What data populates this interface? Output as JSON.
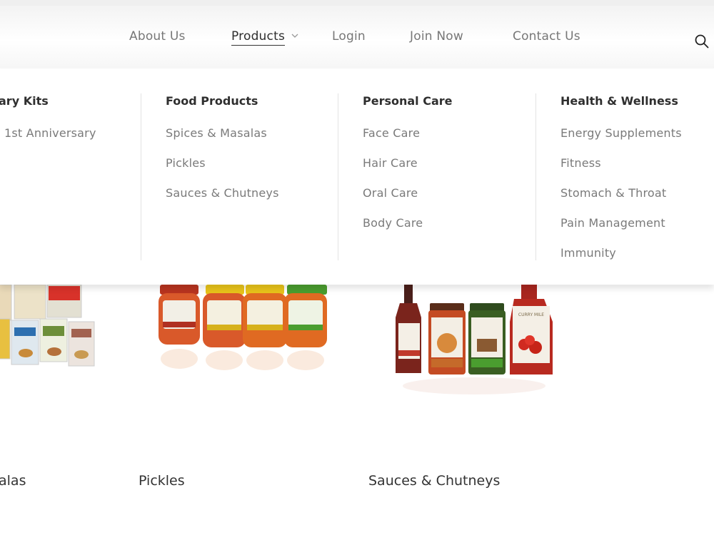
{
  "nav": {
    "items": [
      "About Us",
      "Products",
      "Login",
      "Join Now",
      "Contact Us"
    ]
  },
  "mega": {
    "columns": [
      {
        "title": "ary Kits",
        "links": [
          "1st Anniversary"
        ]
      },
      {
        "title": "Food Products",
        "links": [
          "Spices & Masalas",
          "Pickles",
          "Sauces & Chutneys"
        ]
      },
      {
        "title": "Personal Care",
        "links": [
          "Face Care",
          "Hair Care",
          "Oral Care",
          "Body Care"
        ]
      },
      {
        "title": "Health & Wellness",
        "links": [
          "Energy Supplements",
          "Fitness",
          "Stomach & Throat",
          "Pain Management",
          "Immunity"
        ]
      }
    ]
  },
  "products": {
    "labels": [
      "alas",
      "Pickles",
      "Sauces & Chutneys"
    ],
    "jar_brand": "CURRY MILE"
  },
  "colors": {
    "accent_red": "#c0392b",
    "jar_yellow": "#e8c31a",
    "jar_green": "#4a9d2f",
    "sauce_red": "#a8261f"
  }
}
